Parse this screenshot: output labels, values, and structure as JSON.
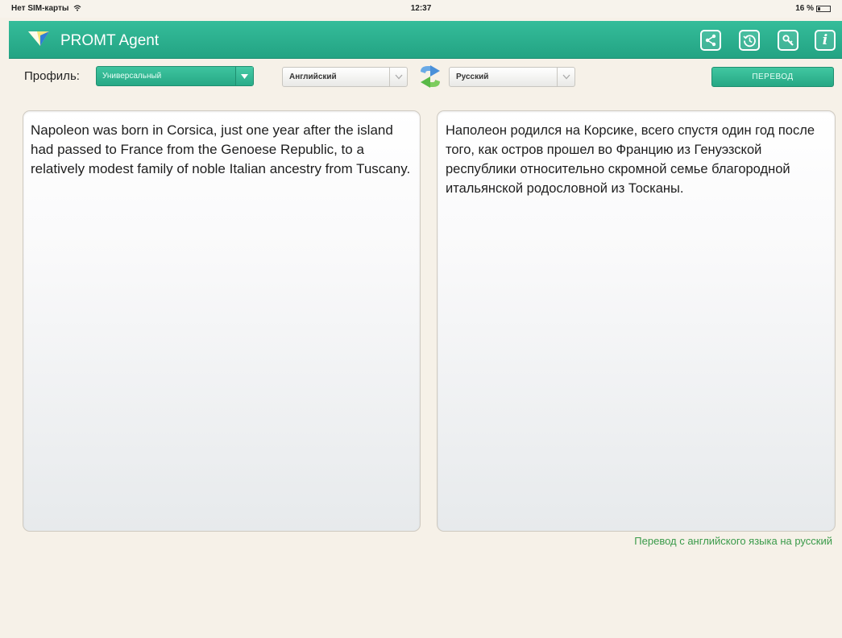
{
  "status_bar": {
    "carrier": "Нет SIM-карты",
    "time": "12:37",
    "battery": "16 %"
  },
  "header": {
    "title": "PROMT Agent",
    "buttons": [
      "share-icon",
      "history-icon",
      "settings-icon",
      "info-icon"
    ],
    "info_glyph": "i",
    "accent_color": "#2bb08e"
  },
  "toolbar": {
    "profile_label": "Профиль:",
    "profile_value": "Универсальный",
    "source_language": "Английский",
    "target_language": "Русский",
    "translate_label": "ПЕРЕВОД"
  },
  "source_text": "Napoleon was born in Corsica, just one year after the island had passed to France from the Genoese Republic, to a relatively modest family of noble Italian ancestry from Tuscany.",
  "translated_text": "Наполеон родился на Корсике, всего спустя один год после того, как остров прошел во Францию из Генуэзской республики относительно скромной семье благородной итальянской родословной из Тосканы.",
  "direction_note": "Перевод с английского языка на русский"
}
